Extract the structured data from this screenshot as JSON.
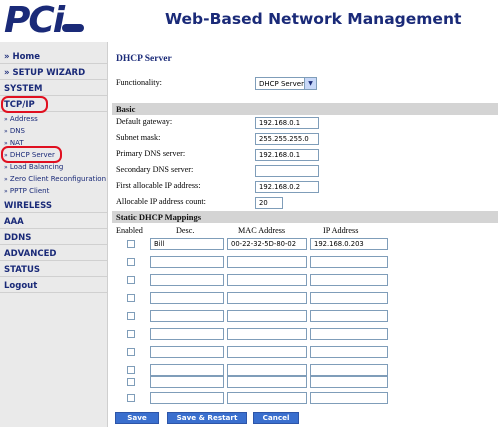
{
  "header": {
    "logo_text": "PCi",
    "app_title": "Web-Based Network Management"
  },
  "sidebar": {
    "main_items": [
      {
        "label": "» Home"
      },
      {
        "label": "» SETUP WIZARD"
      },
      {
        "label": "SYSTEM"
      },
      {
        "label": "TCP/IP"
      },
      {
        "label": "WIRELESS"
      },
      {
        "label": "AAA"
      },
      {
        "label": "DDNS"
      },
      {
        "label": "ADVANCED"
      },
      {
        "label": "STATUS"
      },
      {
        "label": "Logout"
      }
    ],
    "sub_items": [
      {
        "label": "Address"
      },
      {
        "label": "DNS"
      },
      {
        "label": "NAT"
      },
      {
        "label": "DHCP Server"
      },
      {
        "label": "Load Balancing"
      },
      {
        "label": "Zero Client Reconfiguration"
      },
      {
        "label": "PPTP Client"
      }
    ],
    "sub_arrow": "»"
  },
  "main": {
    "page_title": "DHCP Server",
    "functionality_label": "Functionality:",
    "functionality_value": "DHCP Server",
    "basic": {
      "title": "Basic",
      "fields": [
        {
          "label": "Default gateway:",
          "value": "192.168.0.1"
        },
        {
          "label": "Subnet mask:",
          "value": "255.255.255.0"
        },
        {
          "label": "Primary DNS server:",
          "value": "192.168.0.1"
        },
        {
          "label": "Secondary DNS server:",
          "value": ""
        },
        {
          "label": "First allocable IP address:",
          "value": "192.168.0.2"
        },
        {
          "label": "Allocable IP address count:",
          "value": "20"
        }
      ]
    },
    "static": {
      "title": "Static DHCP Mappings",
      "columns": [
        "Enabled",
        "Desc.",
        "MAC Address",
        "IP Address"
      ],
      "rows": [
        {
          "enabled": false,
          "desc": "Bill",
          "mac": "00-22-32-5D-80-02",
          "ip": "192.168.0.203"
        },
        {
          "enabled": false,
          "desc": "",
          "mac": "",
          "ip": ""
        },
        {
          "enabled": false,
          "desc": "",
          "mac": "",
          "ip": ""
        },
        {
          "enabled": false,
          "desc": "",
          "mac": "",
          "ip": ""
        },
        {
          "enabled": false,
          "desc": "",
          "mac": "",
          "ip": ""
        },
        {
          "enabled": false,
          "desc": "",
          "mac": "",
          "ip": ""
        },
        {
          "enabled": false,
          "desc": "",
          "mac": "",
          "ip": ""
        },
        {
          "enabled": false,
          "desc": "",
          "mac": "",
          "ip": ""
        },
        {
          "enabled": false,
          "desc": "",
          "mac": "",
          "ip": ""
        },
        {
          "enabled": false,
          "desc": "",
          "mac": "",
          "ip": ""
        }
      ]
    },
    "buttons": {
      "save": "Save",
      "save_restart": "Save & Restart",
      "cancel": "Cancel"
    }
  },
  "colors": {
    "brand": "#1a2a78",
    "button": "#3a6fce",
    "highlight_circle": "#e01020"
  }
}
